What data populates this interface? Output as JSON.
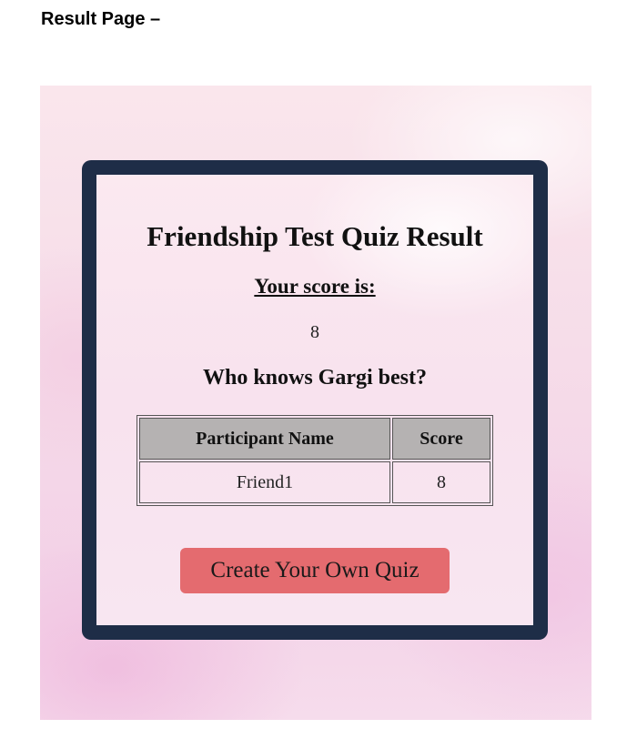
{
  "document": {
    "heading": "Result Page –"
  },
  "quiz": {
    "title": "Friendship Test Quiz Result",
    "score_label": "Your score is:",
    "score_value": "8",
    "who_knows": "Who knows Gargi best?",
    "table": {
      "headers": [
        "Participant Name",
        "Score"
      ],
      "rows": [
        {
          "name": "Friend1",
          "score": "8"
        }
      ]
    },
    "create_button_label": "Create Your Own Quiz"
  },
  "colors": {
    "frame_border": "#1e2d47",
    "table_header_bg": "#b5b2b2",
    "button_bg": "#e46b6f"
  }
}
